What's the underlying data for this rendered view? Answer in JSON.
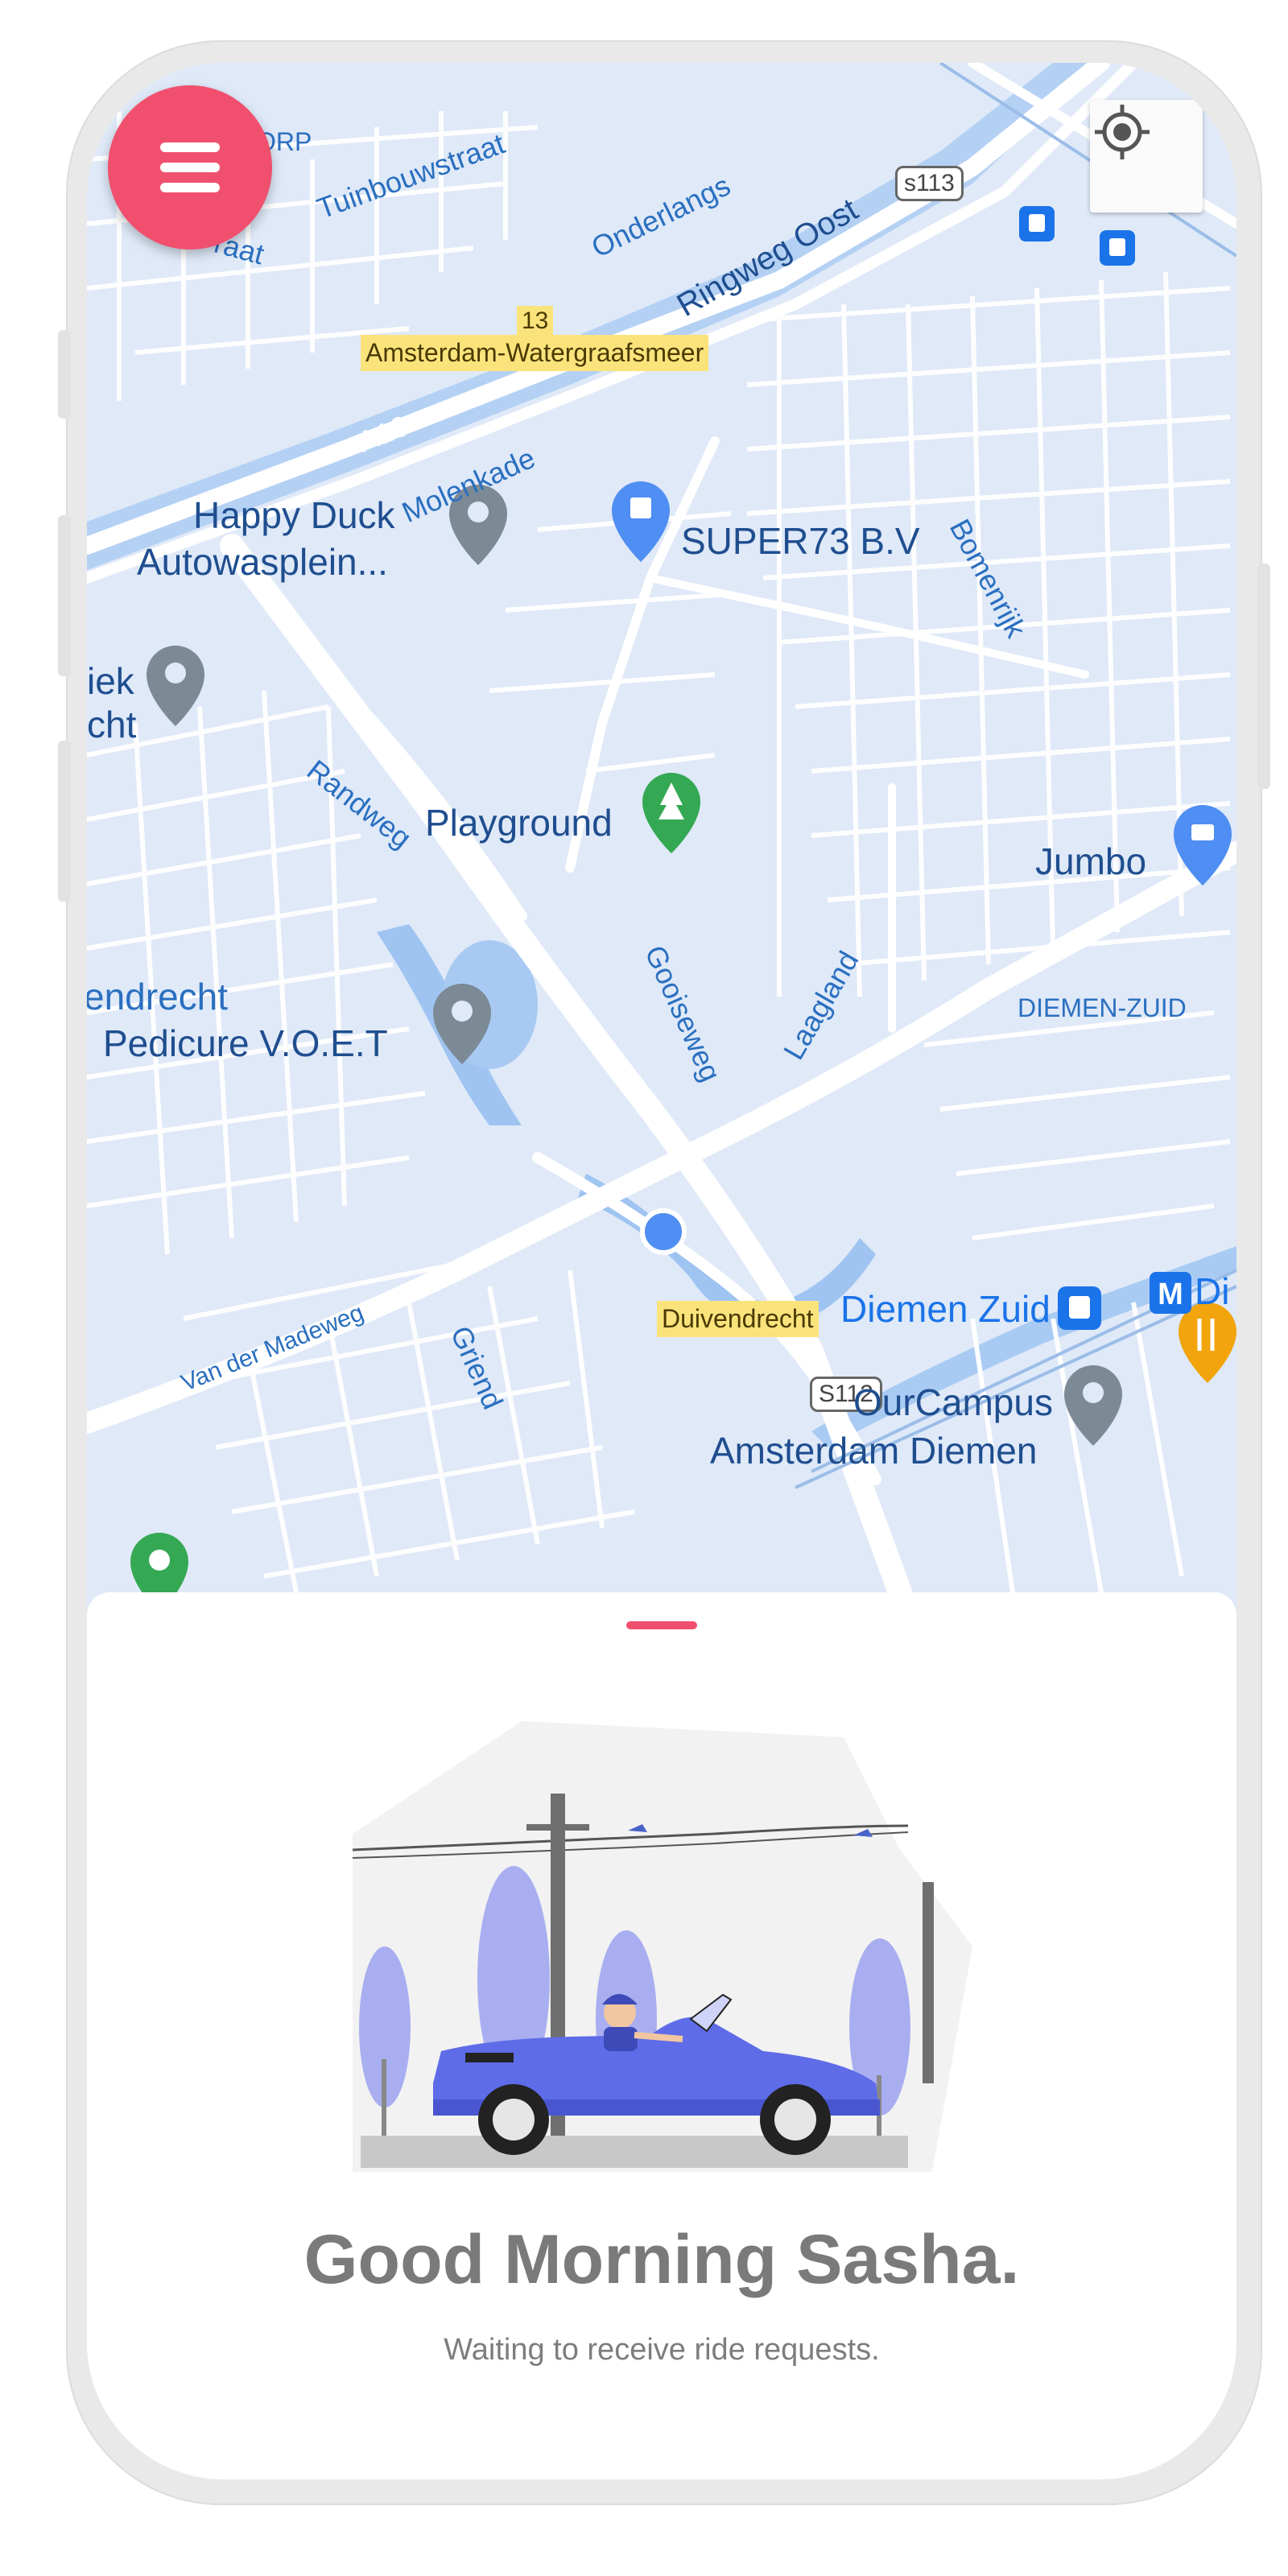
{
  "map": {
    "area_labels": {
      "dorp": "ORP",
      "tuinbouwstraat": "Tuinbouwstraat",
      "raat": "raat",
      "onderlangs": "Onderlangs",
      "ringweg": "Ringweg Oost",
      "s113": "s113",
      "a10_13": "13",
      "watergraafsmeer": "Amsterdam-Watergraafsmeer",
      "a10": "A10",
      "molenkade": "Molenkade",
      "bomenrijk": "Bomenrijk",
      "randweg": "Randweg",
      "gooiseweg": "Gooiseweg",
      "laagland": "Laagland",
      "diemen_zuid_area": "DIEMEN-ZUID",
      "endrecht": "endrecht",
      "van_der_madeweg": "Van der Madeweg",
      "griend": "Griend",
      "duivendrecht": "Duivendrecht",
      "s112": "S112",
      "iek": "iek",
      "cht": "cht",
      "di": "Di"
    },
    "pois": {
      "happy_duck": "Happy Duck",
      "autowasplein": "Autowasplein...",
      "super73": "SUPER73 B.V",
      "playground": "Playground",
      "jumbo": "Jumbo",
      "pedicure": "Pedicure V.O.E.T",
      "diemen_zuid": "Diemen Zuid",
      "ourcampus": "OurCampus",
      "amsterdam_diemen": "Amsterdam Diemen"
    }
  },
  "buttons": {
    "menu_icon": "menu-icon",
    "locate_icon": "my-location-icon"
  },
  "sheet": {
    "greeting": "Good Morning Sasha.",
    "status": "Waiting to receive ride requests."
  },
  "colors": {
    "accent": "#f0506e",
    "car": "#5e6ce8",
    "map_background": "#dfe9f8"
  }
}
